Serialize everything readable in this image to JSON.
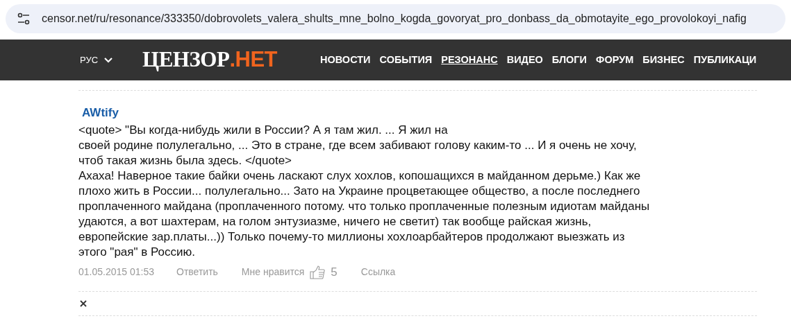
{
  "address_bar": {
    "url": "censor.net/ru/resonance/333350/dobrovolets_valera_shults_mne_bolno_kogda_govoryat_pro_donbass_da_obmotayite_ego_provolokoyi_nafig"
  },
  "header": {
    "language": "РУС",
    "logo": {
      "main": "ЦЕНЗОР",
      "accent": ".НЕТ"
    },
    "nav": [
      {
        "label": "НОВОСТИ",
        "selected": false
      },
      {
        "label": "СОБЫТИЯ",
        "selected": false
      },
      {
        "label": "РЕЗОНАНС",
        "selected": true
      },
      {
        "label": "ВИДЕО",
        "selected": false
      },
      {
        "label": "БЛОГИ",
        "selected": false
      },
      {
        "label": "ФОРУМ",
        "selected": false
      },
      {
        "label": "БИЗНЕС",
        "selected": false
      },
      {
        "label": "ПУБЛИКАЦИ",
        "selected": false
      }
    ]
  },
  "comment": {
    "author": "AWtify",
    "paragraphs": [
      [
        "<quote> \"Вы когда-нибудь жили в России? А я там жил. ... Я жил на",
        "своей родине полулегально, ... Это в стране, где всем забивают голову каким-то ... И я очень не хочу,",
        "чтоб такая жизнь была здесь. </quote>"
      ],
      [
        "Ахаха! Наверное такие байки очень ласкают слух хохлов, копошащихся в майданном дерьме.) Как же",
        "плохо жить в России... полулегально... Зато на Украине процветающее общество, а после последнего",
        "проплаченного майдана (проплаченного потому. что только проплаченные полезным идиотам майданы",
        "удаются, а вот шахтерам, на голом энтузиазме, ничего не светит) так вообще райская жизнь,",
        "европейские зар.платы...)) Только почему-то миллионы хохлоарбайтеров продолжают выезжать из",
        "этого \"рая\" в Россию."
      ]
    ],
    "date": "01.05.2015 01:53",
    "reply": "Ответить",
    "like_label": "Мне нравится",
    "likes": "5",
    "link": "Ссылка"
  }
}
